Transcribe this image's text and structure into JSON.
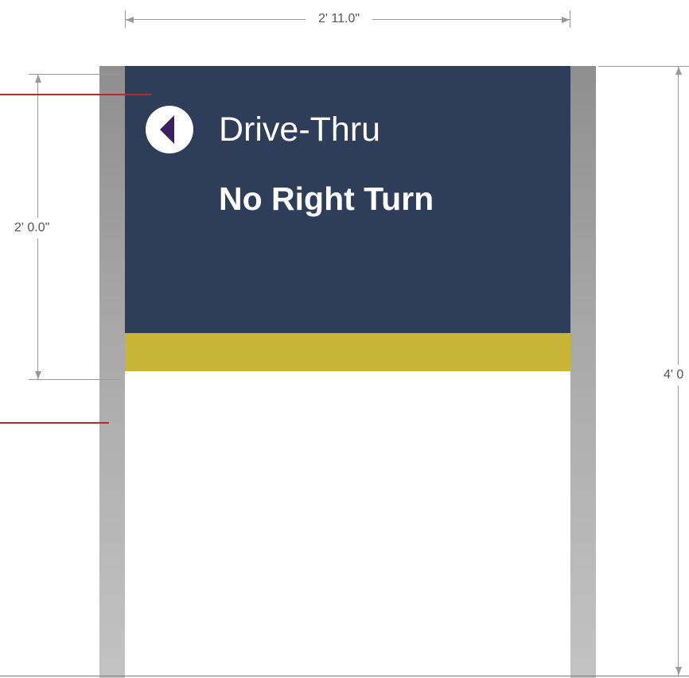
{
  "sign": {
    "line1": "Drive-Thru",
    "line2": "No Right Turn",
    "arrow_icon": "arrow-left-icon",
    "colors": {
      "panel": "#2e3d58",
      "band": "#c8b536",
      "text": "#ffffff",
      "arrow": "#3a2160",
      "posts": "#a9a9a9"
    }
  },
  "dimensions": {
    "width": "2' 11.0\"",
    "panel_height": "2' 0.0\"",
    "overall_height": "4' 0"
  },
  "leader_color": "#b52a2a"
}
